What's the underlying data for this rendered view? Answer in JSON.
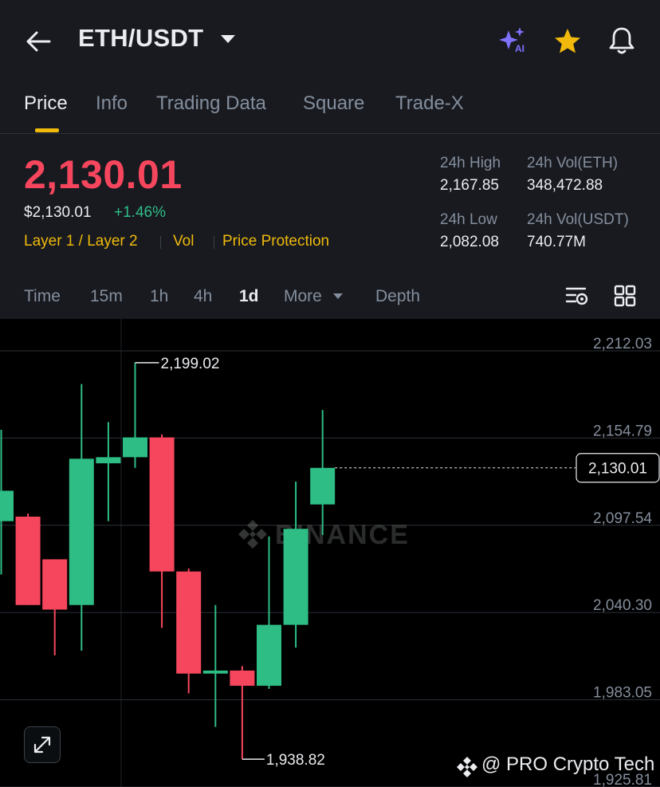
{
  "header": {
    "pair": "ETH/USDT",
    "icons": {
      "back": "back-arrow-icon",
      "caret": "caret-down-icon",
      "ai": "ai-sparkle-icon",
      "star": "star-icon",
      "bell": "bell-icon"
    },
    "ai_badge": "AI",
    "favorite_color": "#f0b90b",
    "ai_color": "#7f72ff"
  },
  "tabs": [
    {
      "label": "Price",
      "active": true
    },
    {
      "label": "Info",
      "active": false
    },
    {
      "label": "Trading Data",
      "active": false
    },
    {
      "label": "Square",
      "active": false
    },
    {
      "label": "Trade-X",
      "active": false
    }
  ],
  "ticker": {
    "last_price": "2,130.01",
    "fiat_price": "$2,130.01",
    "change": "+1.46%",
    "tags": [
      "Layer 1 / Layer 2",
      "Vol",
      "Price Protection"
    ],
    "stats": {
      "high_label": "24h High",
      "high_value": "2,167.85",
      "vol_eth_label": "24h Vol(ETH)",
      "vol_eth_value": "348,472.88",
      "low_label": "24h Low",
      "low_value": "2,082.08",
      "vol_usdt_label": "24h Vol(USDT)",
      "vol_usdt_value": "740.77M"
    }
  },
  "intervals": {
    "items": [
      "Time",
      "15m",
      "1h",
      "4h",
      "1d",
      "More",
      "Depth"
    ],
    "active": "1d",
    "icons": [
      "chart-settings-icon",
      "layout-grid-icon"
    ]
  },
  "colors": {
    "up": "#2ebd85",
    "down": "#f6465d",
    "accent": "#f0b90b"
  },
  "chart_data": {
    "type": "candlestick",
    "interval": "1d",
    "y_ticks": [
      "2,212.03",
      "2,154.79",
      "2,097.54",
      "2,040.30",
      "1,983.05",
      "1,925.81"
    ],
    "ylim": [
      1925.81,
      2212.03
    ],
    "last_price_label": "2,130.01",
    "last_price": 2130.01,
    "high_marker": {
      "label": "2,199.02",
      "value": 2199.02
    },
    "low_marker": {
      "label": "1,938.82",
      "value": 1938.82
    },
    "watermark": "BINANCE",
    "candles": [
      {
        "o": 2095,
        "h": 2155,
        "l": 2060,
        "c": 2115
      },
      {
        "o": 2098,
        "h": 2100,
        "l": 2040,
        "c": 2040
      },
      {
        "o": 2070,
        "h": 2070,
        "l": 2007,
        "c": 2037
      },
      {
        "o": 2040,
        "h": 2185,
        "l": 2010,
        "c": 2136
      },
      {
        "o": 2133,
        "h": 2160,
        "l": 2095,
        "c": 2137
      },
      {
        "o": 2137,
        "h": 2199.02,
        "l": 2130,
        "c": 2150
      },
      {
        "o": 2150,
        "h": 2152,
        "l": 2025,
        "c": 2062
      },
      {
        "o": 2062,
        "h": 2064,
        "l": 1982,
        "c": 1995
      },
      {
        "o": 1995,
        "h": 2040,
        "l": 1960,
        "c": 1997
      },
      {
        "o": 1997,
        "h": 2000,
        "l": 1938.82,
        "c": 1987
      },
      {
        "o": 1987,
        "h": 2085,
        "l": 1985,
        "c": 2027
      },
      {
        "o": 2027,
        "h": 2121,
        "l": 2012,
        "c": 2090
      },
      {
        "o": 2106,
        "h": 2168,
        "l": 2086,
        "c": 2130.01
      }
    ]
  },
  "footer": {
    "expand_icon": "expand-icon",
    "credit": "@ PRO Crypto Tech",
    "credit_icon": "binance-logo-icon"
  }
}
